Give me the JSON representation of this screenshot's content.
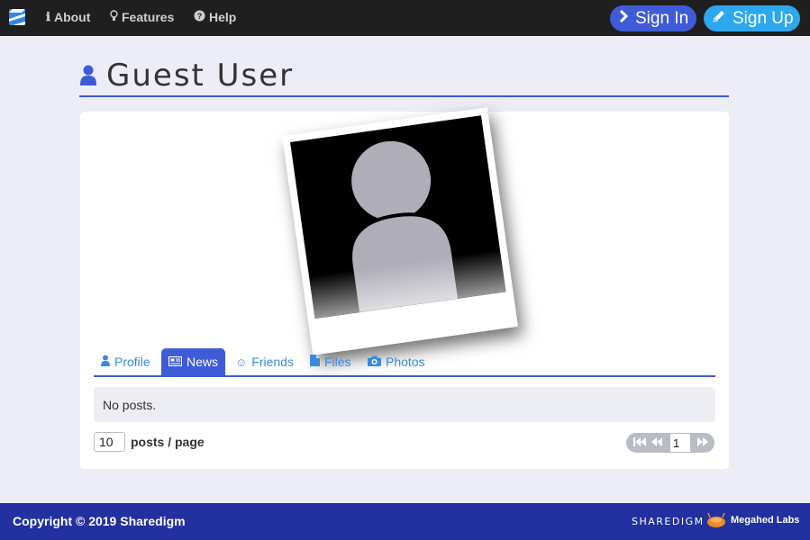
{
  "navbar": {
    "about_label": "About",
    "features_label": "Features",
    "help_label": "Help",
    "signin_label": "Sign In",
    "signup_label": "Sign Up"
  },
  "page": {
    "title": "Guest User"
  },
  "tabs": [
    {
      "label": "Profile",
      "icon": "user-icon",
      "active": false
    },
    {
      "label": "News",
      "icon": "newspaper-icon",
      "active": true
    },
    {
      "label": "Friends",
      "icon": "smile-icon",
      "active": false
    },
    {
      "label": "Files",
      "icon": "file-icon",
      "active": false
    },
    {
      "label": "Photos",
      "icon": "camera-icon",
      "active": false
    }
  ],
  "posts": {
    "empty_message": "No posts.",
    "per_page_value": "10",
    "per_page_label": "posts / page",
    "current_page": "1"
  },
  "footer": {
    "copyright": "Copyright © 2019 Sharedigm",
    "brand": "SHAREDIGM",
    "lab_name": "Megahed Labs"
  },
  "colors": {
    "navbar_bg": "#1f1f1f",
    "signin_bg": "#3f5bd8",
    "signup_bg": "#2da7ee",
    "accent": "#3b5bd6",
    "link": "#3a8be0",
    "footer_bg": "#22319f",
    "page_bg": "#ededf7"
  }
}
